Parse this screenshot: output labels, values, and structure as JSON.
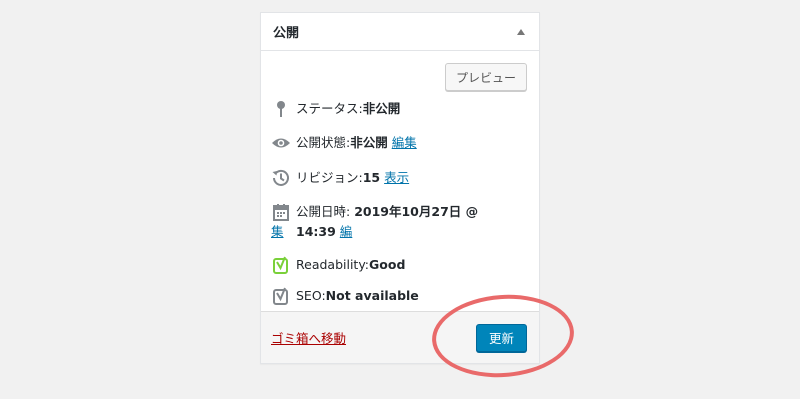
{
  "panel": {
    "title": "公開",
    "preview_label": "プレビュー"
  },
  "status": {
    "label": "ステータス: ",
    "value": "非公開"
  },
  "visibility": {
    "label": "公開状態: ",
    "value": "非公開",
    "edit_link": "編集"
  },
  "revisions": {
    "label": "リビジョン: ",
    "value": "15",
    "link": "表示"
  },
  "publish_date": {
    "label": "公開日時: ",
    "value": "2019年10月27日 @ 14:39",
    "edit_link_part1": "編",
    "edit_link_part2": "集"
  },
  "readability": {
    "label": "Readability: ",
    "value": "Good"
  },
  "seo": {
    "label": "SEO: ",
    "value": "Not available"
  },
  "footer": {
    "trash_label": "ゴミ箱へ移動",
    "update_label": "更新"
  },
  "icons": {
    "status": "pin-icon",
    "visibility": "eye-icon",
    "revisions": "history-icon",
    "date": "calendar-icon",
    "readability": "yoast-icon",
    "seo": "yoast-icon"
  },
  "colors": {
    "link": "#0073aa",
    "trash": "#a00000",
    "primary_button": "#0085ba",
    "highlight_circle": "#e96a6a",
    "readability_good": "#7ad03a"
  }
}
